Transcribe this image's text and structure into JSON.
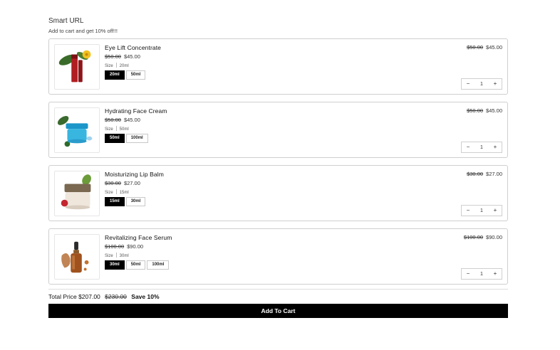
{
  "header": {
    "title": "Smart URL",
    "subtitle": "Add to cart and get 10% off!!!"
  },
  "products": [
    {
      "name": "Eye Lift Concentrate",
      "original_price": "$50.00",
      "price": "$45.00",
      "size_label": "Size",
      "size_value": "20ml",
      "options": [
        "20ml",
        "50ml"
      ],
      "selected_option": "20ml",
      "quantity": "1",
      "image_icon": "red-serum-bottle-with-flower"
    },
    {
      "name": "Hydrating Face Cream",
      "original_price": "$50.00",
      "price": "$45.00",
      "size_label": "Size",
      "size_value": "50ml",
      "options": [
        "50ml",
        "100ml"
      ],
      "selected_option": "50ml",
      "quantity": "1",
      "image_icon": "blue-cream-jar"
    },
    {
      "name": "Moisturizing Lip Balm",
      "original_price": "$30.00",
      "price": "$27.00",
      "size_label": "Size",
      "size_value": "15ml",
      "options": [
        "15ml",
        "30ml"
      ],
      "selected_option": "15ml",
      "quantity": "1",
      "image_icon": "beige-balm-jar-with-berry"
    },
    {
      "name": "Revitalizing Face Serum",
      "original_price": "$100.00",
      "price": "$90.00",
      "size_label": "Size",
      "size_value": "30ml",
      "options": [
        "30ml",
        "50ml",
        "100ml"
      ],
      "selected_option": "30ml",
      "quantity": "1",
      "image_icon": "amber-dropper-bottle"
    }
  ],
  "stepper": {
    "minus": "−",
    "plus": "+"
  },
  "summary": {
    "label": "Total Price",
    "total": "$207.00",
    "original_total": "$230.00",
    "savings": "Save 10%"
  },
  "cta": {
    "label": "Add To Cart"
  },
  "colors": {
    "accent": "#000000",
    "border": "#cfcfcf"
  }
}
